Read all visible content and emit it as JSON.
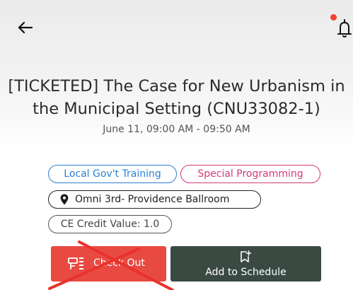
{
  "header": {
    "back_icon": "arrow-left-icon",
    "notification_icon": "bell-icon",
    "notification_dot_color": "#f04134"
  },
  "session": {
    "title": "[TICKETED] The Case for New Urbanism in the Municipal Setting (CNU33082-1)",
    "time": "June 11, 09:00 AM - 09:50 AM"
  },
  "tags": {
    "training": "Local Gov't Training",
    "programming": "Special Programming",
    "location": "Omni 3rd- Providence Ballroom",
    "location_icon": "map-pin-icon",
    "ce_credit": "CE Credit Value: 1.0"
  },
  "actions": {
    "checkout_label": "Check Out",
    "checkout_icon": "checkout-icon",
    "checkout_color": "#e84a42",
    "schedule_label": "Add to Schedule",
    "schedule_icon": "bookmark-add-icon",
    "schedule_color": "#3a4a43"
  },
  "overlay": {
    "cross_color": "#e8332a"
  },
  "colors": {
    "tag_blue": "#2d7fd0",
    "tag_pink": "#d23a78"
  }
}
